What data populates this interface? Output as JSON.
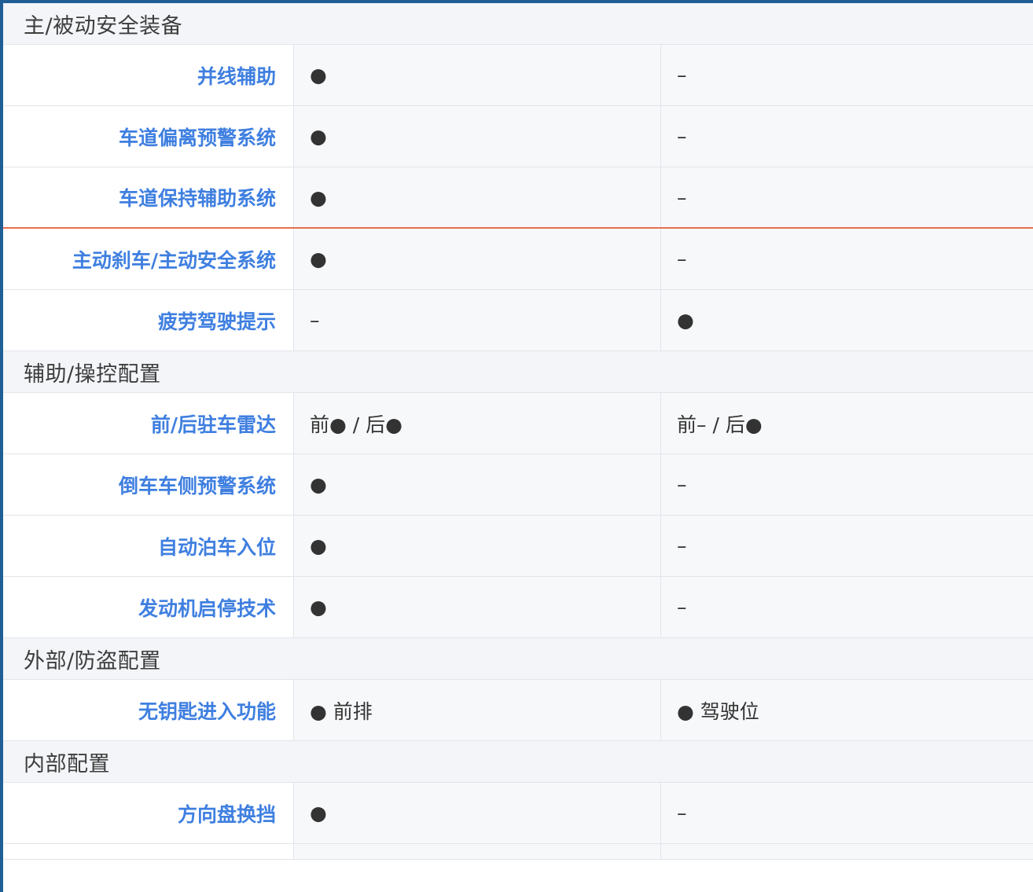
{
  "table": {
    "sections": [
      {
        "title": "主/被动安全装备",
        "rows": [
          {
            "label": "并线辅助",
            "v1": "●",
            "v2": "–"
          },
          {
            "label": "车道偏离预警系统",
            "v1": "●",
            "v2": "–"
          },
          {
            "label": "车道保持辅助系统",
            "v1": "●",
            "v2": "–"
          },
          {
            "label": "主动刹车/主动安全系统",
            "v1": "●",
            "v2": "–"
          },
          {
            "label": "疲劳驾驶提示",
            "v1": "–",
            "v2": "●"
          }
        ]
      },
      {
        "title": "辅助/操控配置",
        "rows": [
          {
            "label": "前/后驻车雷达",
            "v1": "前● / 后●",
            "v2": "前– / 后●"
          },
          {
            "label": "倒车车侧预警系统",
            "v1": "●",
            "v2": "–"
          },
          {
            "label": "自动泊车入位",
            "v1": "●",
            "v2": "–"
          },
          {
            "label": "发动机启停技术",
            "v1": "●",
            "v2": "–"
          }
        ]
      },
      {
        "title": "外部/防盗配置",
        "rows": [
          {
            "label": "无钥匙进入功能",
            "v1": "● 前排",
            "v2": "● 驾驶位"
          }
        ]
      },
      {
        "title": "内部配置",
        "rows": [
          {
            "label": "方向盘换挡",
            "v1": "●",
            "v2": "–"
          }
        ]
      }
    ]
  },
  "colors": {
    "label_blue": "#3f7fe0",
    "divider_orange": "#e86f4f",
    "frame_blue": "#1f5f96"
  }
}
